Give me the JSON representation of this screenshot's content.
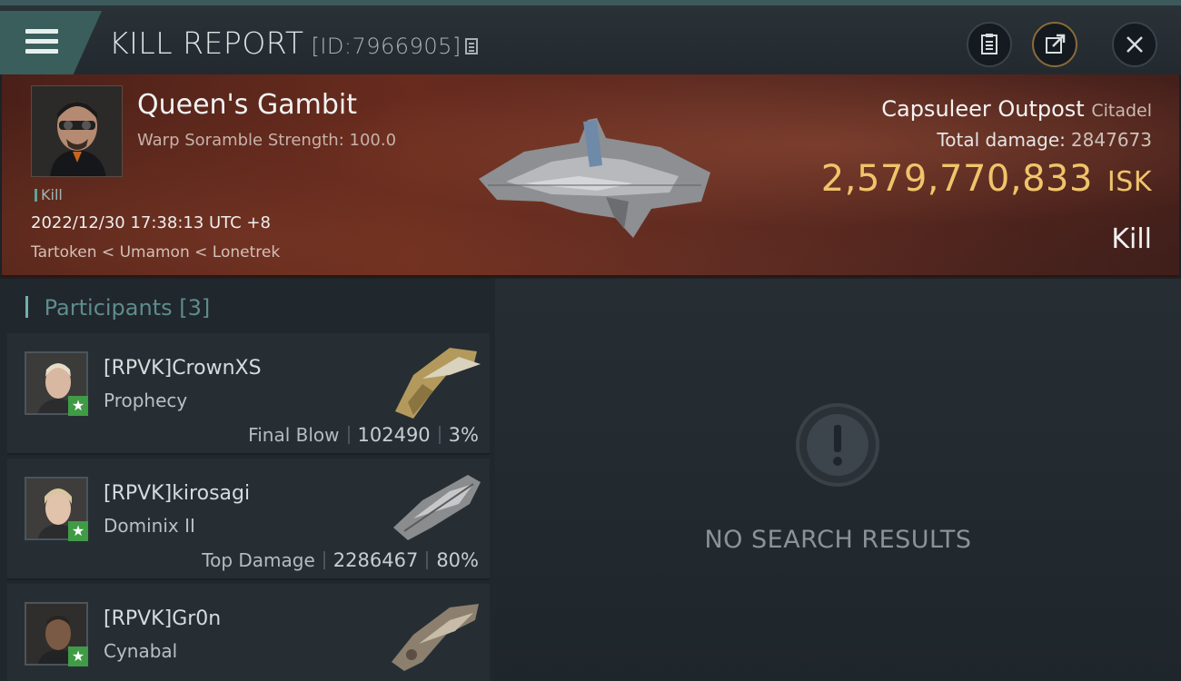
{
  "header": {
    "title": "KILL REPORT",
    "report_id": "[ID:7966905]"
  },
  "victim": {
    "name": "Queen's Gambit",
    "subtitle": "Warp Soramble Strength: 100.0",
    "tag": "Kill",
    "timestamp": "2022/12/30 17:38:13 UTC +8",
    "location": "Tartoken < Umamon < Lonetrek"
  },
  "summary": {
    "structure_name": "Capsuleer Outpost",
    "structure_class": "Citadel",
    "damage_label": "Total damage:",
    "damage_value": "2847673",
    "isk_value": "2,579,770,833",
    "isk_unit": "ISK",
    "type": "Kill"
  },
  "participants": {
    "header_label": "Participants",
    "header_count": "[3]",
    "rows": [
      {
        "name": "[RPVK]CrownXS",
        "ship": "Prophecy",
        "label": "Final Blow",
        "damage": "102490",
        "pct": "3%"
      },
      {
        "name": "[RPVK]kirosagi",
        "ship": "Dominix II",
        "label": "Top Damage",
        "damage": "2286467",
        "pct": "80%"
      },
      {
        "name": "[RPVK]Gr0n",
        "ship": "Cynabal"
      }
    ]
  },
  "empty_state": {
    "text": "NO SEARCH RESULTS"
  },
  "colors": {
    "accent_teal": "#3a5e5b",
    "isk_gold": "#f0c46a",
    "star_green": "#3f9b45"
  },
  "icons": [
    "menu-icon",
    "copy-icon",
    "clipboard-icon",
    "share-icon",
    "close-icon",
    "alert-icon",
    "star-icon"
  ]
}
